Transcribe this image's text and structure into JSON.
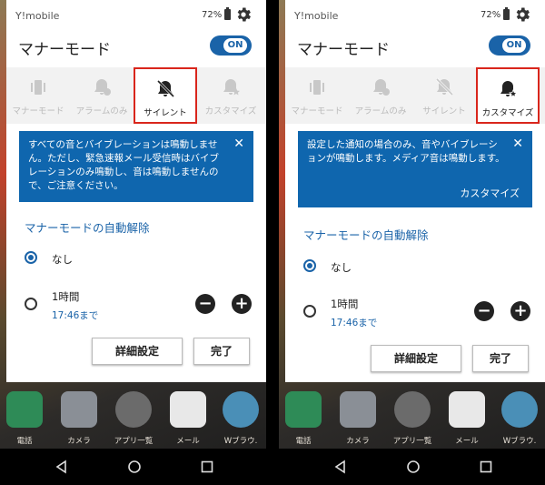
{
  "screens": [
    {
      "status": {
        "carrier": "Y!mobile",
        "battery": "72%"
      },
      "title": "マナーモード",
      "toggle": "ON",
      "modes": [
        {
          "label": "マナーモード",
          "icon": "vibrate-icon"
        },
        {
          "label": "アラームのみ",
          "icon": "alarm-bell-icon"
        },
        {
          "label": "サイレント",
          "icon": "bell-off-icon",
          "selected": true
        },
        {
          "label": "カスタマイズ",
          "icon": "bell-star-icon"
        }
      ],
      "info": "すべての音とバイブレーションは鳴動しません。ただし、緊急速報メール受信時はバイブレーションのみ鳴動し、音は鳴動しませんので、ご注意ください。",
      "section": "マナーモードの自動解除",
      "option_none": "なし",
      "option_hour": "1時間",
      "option_hour_sub": "17:46まで",
      "detail_button": "詳細設定",
      "done_button": "完了"
    },
    {
      "status": {
        "carrier": "Y!mobile",
        "battery": "72%"
      },
      "title": "マナーモード",
      "toggle": "ON",
      "modes": [
        {
          "label": "マナーモード",
          "icon": "vibrate-icon"
        },
        {
          "label": "アラームのみ",
          "icon": "alarm-bell-icon"
        },
        {
          "label": "サイレント",
          "icon": "bell-off-icon"
        },
        {
          "label": "カスタマイズ",
          "icon": "bell-star-icon",
          "selected": true
        }
      ],
      "info": "設定した通知の場合のみ、音やバイブレーションが鳴動します。メディア音は鳴動します。",
      "info_link": "カスタマイズ",
      "section": "マナーモードの自動解除",
      "option_none": "なし",
      "option_hour": "1時間",
      "option_hour_sub": "17:46まで",
      "detail_button": "詳細設定",
      "done_button": "完了"
    }
  ],
  "dock": [
    "電話",
    "カメラ",
    "アプリ一覧",
    "メール",
    "Wブラウ."
  ],
  "colors": {
    "accent": "#1a63a8",
    "highlight": "#d9261c"
  }
}
